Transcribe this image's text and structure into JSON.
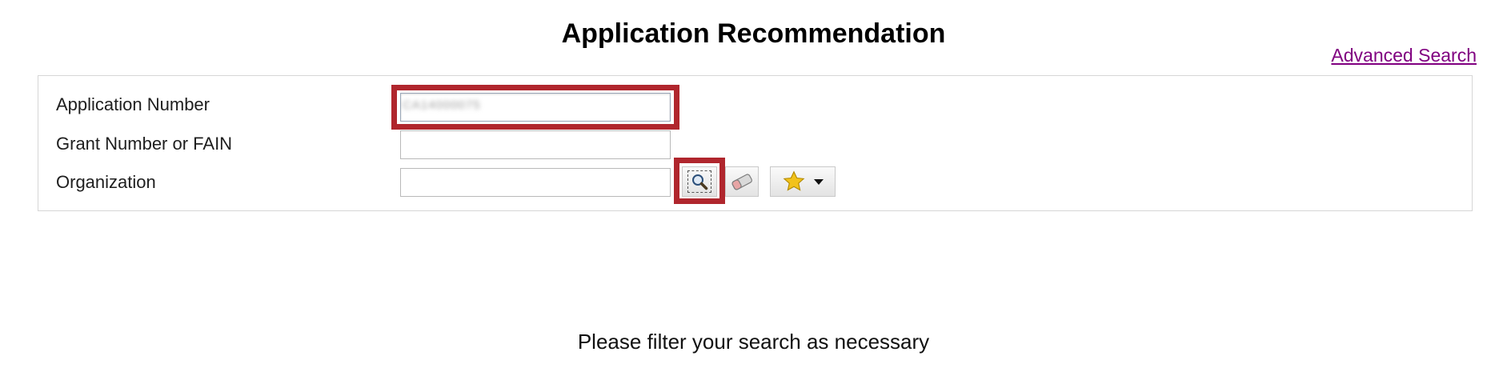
{
  "header": {
    "title": "Application Recommendation",
    "advanced_search_label": "Advanced Search"
  },
  "form": {
    "application_number": {
      "label": "Application Number",
      "value": "CA14000075"
    },
    "grant_number": {
      "label": "Grant Number or FAIN",
      "value": ""
    },
    "organization": {
      "label": "Organization",
      "value": ""
    }
  },
  "toolbar": {
    "lookup_icon": "magnifier-icon",
    "clear_icon": "eraser-icon",
    "favorites_icon": "star-icon",
    "favorites_caret": "chevron-down-icon"
  },
  "status": {
    "message": "Please filter your search as necessary"
  },
  "colors": {
    "highlight": "#b0262d",
    "link": "#800080",
    "star": "#f2c21b"
  }
}
